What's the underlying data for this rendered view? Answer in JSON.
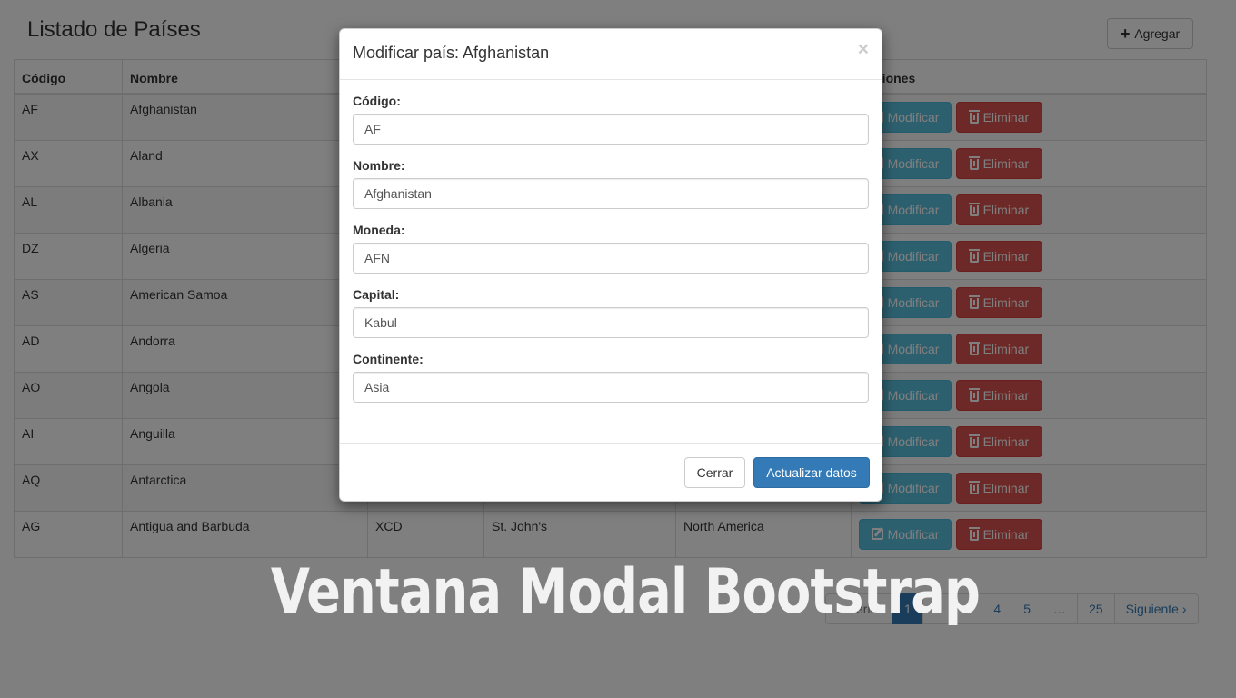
{
  "page": {
    "title": "Listado de Países",
    "add_label": "Agregar"
  },
  "table": {
    "headers": [
      "Código",
      "Nombre",
      "",
      "",
      "",
      "Acciones"
    ],
    "rows": [
      {
        "code": "AF",
        "name": "Afghanistan",
        "currency": "",
        "capital": "",
        "continent": ""
      },
      {
        "code": "AX",
        "name": "Aland",
        "currency": "",
        "capital": "",
        "continent": ""
      },
      {
        "code": "AL",
        "name": "Albania",
        "currency": "",
        "capital": "",
        "continent": ""
      },
      {
        "code": "DZ",
        "name": "Algeria",
        "currency": "",
        "capital": "",
        "continent": ""
      },
      {
        "code": "AS",
        "name": "American Samoa",
        "currency": "",
        "capital": "",
        "continent": ""
      },
      {
        "code": "AD",
        "name": "Andorra",
        "currency": "",
        "capital": "",
        "continent": ""
      },
      {
        "code": "AO",
        "name": "Angola",
        "currency": "",
        "capital": "",
        "continent": ""
      },
      {
        "code": "AI",
        "name": "Anguilla",
        "currency": "",
        "capital": "",
        "continent": ""
      },
      {
        "code": "AQ",
        "name": "Antarctica",
        "currency": "",
        "capital": "",
        "continent": ""
      },
      {
        "code": "AG",
        "name": "Antigua and Barbuda",
        "currency": "XCD",
        "capital": "St. John's",
        "continent": "North America"
      }
    ],
    "edit_label": "Modificar",
    "delete_label": "Eliminar"
  },
  "pagination": {
    "prev": "Anterior",
    "pages": [
      "1",
      "2",
      "3",
      "4",
      "5",
      "…",
      "25"
    ],
    "active": "1",
    "next": "Siguiente ›"
  },
  "modal": {
    "title": "Modificar país: Afghanistan",
    "close": "×",
    "fields": [
      {
        "label": "Código:",
        "value": "AF"
      },
      {
        "label": "Nombre:",
        "value": "Afghanistan"
      },
      {
        "label": "Moneda:",
        "value": "AFN"
      },
      {
        "label": "Capital:",
        "value": "Kabul"
      },
      {
        "label": "Continente:",
        "value": "Asia"
      }
    ],
    "cancel_label": "Cerrar",
    "submit_label": "Actualizar datos"
  },
  "watermark": "Ventana Modal Bootstrap",
  "colors": {
    "primary": "#337ab7",
    "info": "#5bc0de",
    "danger": "#d9534f"
  }
}
